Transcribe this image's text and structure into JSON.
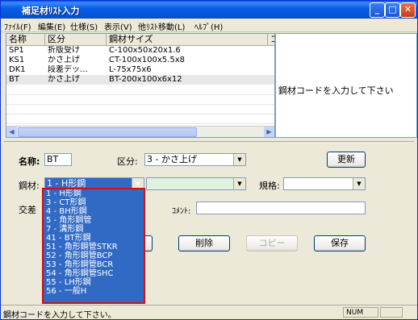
{
  "window": {
    "title": "補足材ﾘｽﾄ入力",
    "min": "_",
    "max": "□",
    "close": "✕"
  },
  "menu": [
    "ﾌｧｲﾙ(F)",
    "編集(E)",
    "仕様(S)",
    "表示(V)",
    "他ﾘｽﾄ移動(L)",
    "ﾍﾙﾌﾟ(H)"
  ],
  "grid": {
    "headers": [
      "名称",
      "区分",
      "鋼材サイズ",
      "コ"
    ],
    "rows": [
      [
        "SP1",
        "折版受け",
        "C-100x50x20x1.6"
      ],
      [
        "KS1",
        "かさ上げ",
        "CT-100x100x5.5x8"
      ],
      [
        "DK1",
        "段差デッ…",
        "L-75x75x6"
      ],
      [
        "BT",
        "かさ上げ",
        "BT-200x100x6x12"
      ]
    ]
  },
  "info_message": "鋼材コードを入力して下さい",
  "form": {
    "name_label": "名称:",
    "name_value": "BT",
    "kubun_label": "区分:",
    "kubun_value": "3 - かさ上げ",
    "update_button": "更新",
    "kozai_label": "鋼材:",
    "kozai_value": "1 - H形鋼",
    "kikaku_label": "規格:",
    "kikaku_value": "",
    "kosa_label": "交差",
    "comment_label": "ｺﾒﾝﾄ:",
    "comment_value": "",
    "delete_button": "削除",
    "copy_button": "コピー",
    "save_button": "保存"
  },
  "dropdown_options": [
    "1 - H形鋼",
    "3 - CT形鋼",
    "4 - BH形鋼",
    "5 - 角形鋼管",
    "7 - 溝形鋼",
    "41 - BT形鋼",
    "51 - 角形鋼管STKR",
    "52 - 角形鋼管BCP",
    "53 - 角形鋼管BCR",
    "54 - 角形鋼管SHC",
    "55 - LH形鋼",
    "56 - 一般H"
  ],
  "status": {
    "message": "鋼材コードを入力して下さい。",
    "num": "NUM"
  }
}
